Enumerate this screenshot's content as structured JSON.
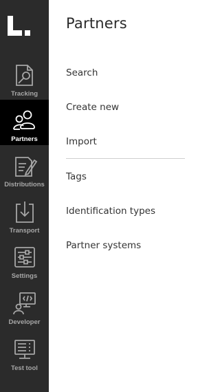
{
  "sidebar": {
    "logo_text": "L.",
    "items": [
      {
        "label": "Tracking",
        "icon": "tracking-icon",
        "active": false
      },
      {
        "label": "Partners",
        "icon": "partners-icon",
        "active": true
      },
      {
        "label": "Distributions",
        "icon": "distributions-icon",
        "active": false
      },
      {
        "label": "Transport",
        "icon": "transport-icon",
        "active": false
      },
      {
        "label": "Settings",
        "icon": "settings-icon",
        "active": false
      },
      {
        "label": "Developer",
        "icon": "developer-icon",
        "active": false
      },
      {
        "label": "Test tool",
        "icon": "test-tool-icon",
        "active": false
      }
    ]
  },
  "main": {
    "title": "Partners",
    "menu": [
      {
        "label": "Search"
      },
      {
        "label": "Create new"
      },
      {
        "label": "Import"
      },
      {
        "label": "Tags"
      },
      {
        "label": "Identification types"
      },
      {
        "label": "Partner systems"
      }
    ]
  },
  "colors": {
    "sidebar_bg": "#2b2b2b",
    "sidebar_active_bg": "#000000",
    "icon_color": "#a7a7a7",
    "active_color": "#ffffff",
    "text_color": "#333333"
  }
}
